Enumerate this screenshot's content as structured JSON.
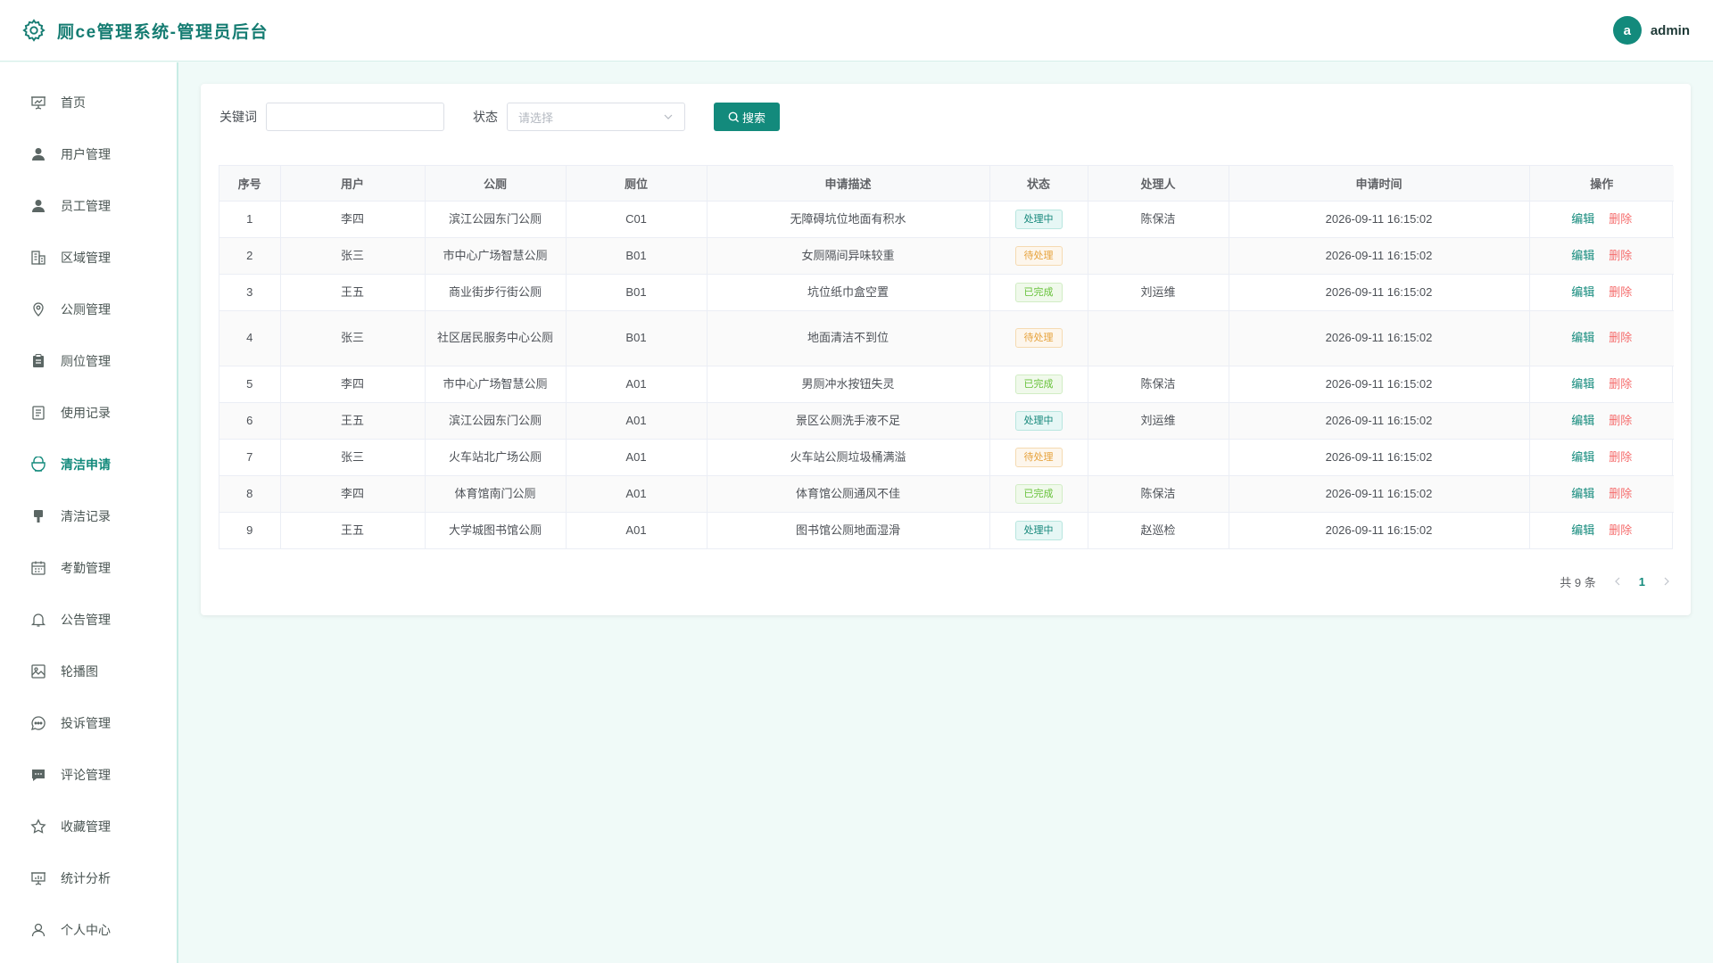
{
  "header": {
    "title": "厕ce管理系统-管理员后台",
    "avatar_letter": "a",
    "username": "admin",
    "brand_color": "#138a7c"
  },
  "sidebar": {
    "items": [
      {
        "label": "首页",
        "icon": "presentation-board-icon",
        "active": false
      },
      {
        "label": "用户管理",
        "icon": "user-filled-icon",
        "active": false
      },
      {
        "label": "员工管理",
        "icon": "user-filled-icon",
        "active": false
      },
      {
        "label": "区域管理",
        "icon": "office-building-icon",
        "active": false
      },
      {
        "label": "公厕管理",
        "icon": "location-pin-icon",
        "active": false
      },
      {
        "label": "厕位管理",
        "icon": "clipboard-icon",
        "active": false
      },
      {
        "label": "使用记录",
        "icon": "document-icon",
        "active": false
      },
      {
        "label": "清洁申请",
        "icon": "coffee-cup-icon",
        "active": true
      },
      {
        "label": "清洁记录",
        "icon": "brush-icon",
        "active": false
      },
      {
        "label": "考勤管理",
        "icon": "calendar-icon",
        "active": false
      },
      {
        "label": "公告管理",
        "icon": "bell-icon",
        "active": false
      },
      {
        "label": "轮播图",
        "icon": "picture-icon",
        "active": false
      },
      {
        "label": "投诉管理",
        "icon": "chat-dots-icon",
        "active": false
      },
      {
        "label": "评论管理",
        "icon": "chat-filled-icon",
        "active": false
      },
      {
        "label": "收藏管理",
        "icon": "star-icon",
        "active": false
      },
      {
        "label": "统计分析",
        "icon": "data-board-icon",
        "active": false
      },
      {
        "label": "个人中心",
        "icon": "user-outline-icon",
        "active": false
      }
    ]
  },
  "filters": {
    "keyword_label": "关键词",
    "keyword_value": "",
    "status_label": "状态",
    "status_placeholder": "请选择",
    "search_label": "搜索"
  },
  "table": {
    "columns": [
      "序号",
      "用户",
      "公厕",
      "厕位",
      "申请描述",
      "状态",
      "处理人",
      "申请时间",
      "操作"
    ],
    "rows": [
      {
        "no": "1",
        "user": "李四",
        "toilet": "滨江公园东门公厕",
        "stall": "C01",
        "desc": "无障碍坑位地面有积水",
        "status": "处理中",
        "status_type": "processing",
        "handler": "陈保洁",
        "time": "2026-09-11 16:15:02"
      },
      {
        "no": "2",
        "user": "张三",
        "toilet": "市中心广场智慧公厕",
        "stall": "B01",
        "desc": "女厕隔间异味较重",
        "status": "待处理",
        "status_type": "pending",
        "handler": "",
        "time": "2026-09-11 16:15:02"
      },
      {
        "no": "3",
        "user": "王五",
        "toilet": "商业街步行街公厕",
        "stall": "B01",
        "desc": "坑位纸巾盒空置",
        "status": "已完成",
        "status_type": "done",
        "handler": "刘运维",
        "time": "2026-09-11 16:15:02"
      },
      {
        "no": "4",
        "user": "张三",
        "toilet": "社区居民服务中心公厕",
        "stall": "B01",
        "desc": "地面清洁不到位",
        "status": "待处理",
        "status_type": "pending",
        "handler": "",
        "time": "2026-09-11 16:15:02"
      },
      {
        "no": "5",
        "user": "李四",
        "toilet": "市中心广场智慧公厕",
        "stall": "A01",
        "desc": "男厕冲水按钮失灵",
        "status": "已完成",
        "status_type": "done",
        "handler": "陈保洁",
        "time": "2026-09-11 16:15:02"
      },
      {
        "no": "6",
        "user": "王五",
        "toilet": "滨江公园东门公厕",
        "stall": "A01",
        "desc": "景区公厕洗手液不足",
        "status": "处理中",
        "status_type": "processing",
        "handler": "刘运维",
        "time": "2026-09-11 16:15:02"
      },
      {
        "no": "7",
        "user": "张三",
        "toilet": "火车站北广场公厕",
        "stall": "A01",
        "desc": "火车站公厕垃圾桶满溢",
        "status": "待处理",
        "status_type": "pending",
        "handler": "",
        "time": "2026-09-11 16:15:02"
      },
      {
        "no": "8",
        "user": "李四",
        "toilet": "体育馆南门公厕",
        "stall": "A01",
        "desc": "体育馆公厕通风不佳",
        "status": "已完成",
        "status_type": "done",
        "handler": "陈保洁",
        "time": "2026-09-11 16:15:02"
      },
      {
        "no": "9",
        "user": "王五",
        "toilet": "大学城图书馆公厕",
        "stall": "A01",
        "desc": "图书馆公厕地面湿滑",
        "status": "处理中",
        "status_type": "processing",
        "handler": "赵巡检",
        "time": "2026-09-11 16:15:02"
      }
    ],
    "edit_label": "编辑",
    "delete_label": "删除"
  },
  "pagination": {
    "total_text": "共 9 条",
    "current_page": "1"
  },
  "colors": {
    "accent": "#138a7c",
    "danger": "#f56c6c",
    "pending": "#e6a23c",
    "done": "#67c23a",
    "background": "#f0faf8"
  }
}
